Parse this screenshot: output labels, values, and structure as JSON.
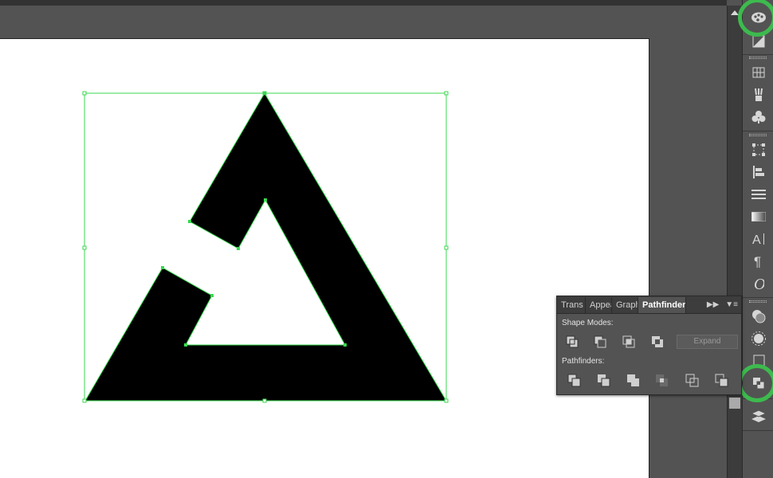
{
  "app": {
    "accent_color": "#3dba4e",
    "selection_color": "#39d94f"
  },
  "canvas": {
    "shape_name": "black-triangle-logo",
    "fill": "#000000"
  },
  "dock": {
    "icons": [
      "palette-icon",
      "gradient-swatch-icon",
      "grid-icon",
      "brushes-icon",
      "symbols-icon",
      "transform-icon",
      "align-icon",
      "stroke-icon",
      "gradient-icon",
      "character-icon",
      "paragraph-icon",
      "opentype-icon",
      "transparency-icon",
      "appearance-icon",
      "graphic-styles-icon",
      "pathfinder-icon",
      "layers-icon"
    ]
  },
  "pathfinder_panel": {
    "tabs": [
      {
        "label": "Trans"
      },
      {
        "label": "Appea"
      },
      {
        "label": "Graph"
      },
      {
        "label": "Pathfinder"
      }
    ],
    "shape_modes_label": "Shape Modes:",
    "expand_label": "Expand",
    "pathfinders_label": "Pathfinders:",
    "shape_mode_buttons": [
      "unite-icon",
      "minus-front-icon",
      "intersect-icon",
      "exclude-icon"
    ],
    "pathfinder_buttons": [
      "divide-icon",
      "trim-icon",
      "merge-icon",
      "crop-icon",
      "outline-icon",
      "minus-back-icon"
    ]
  }
}
